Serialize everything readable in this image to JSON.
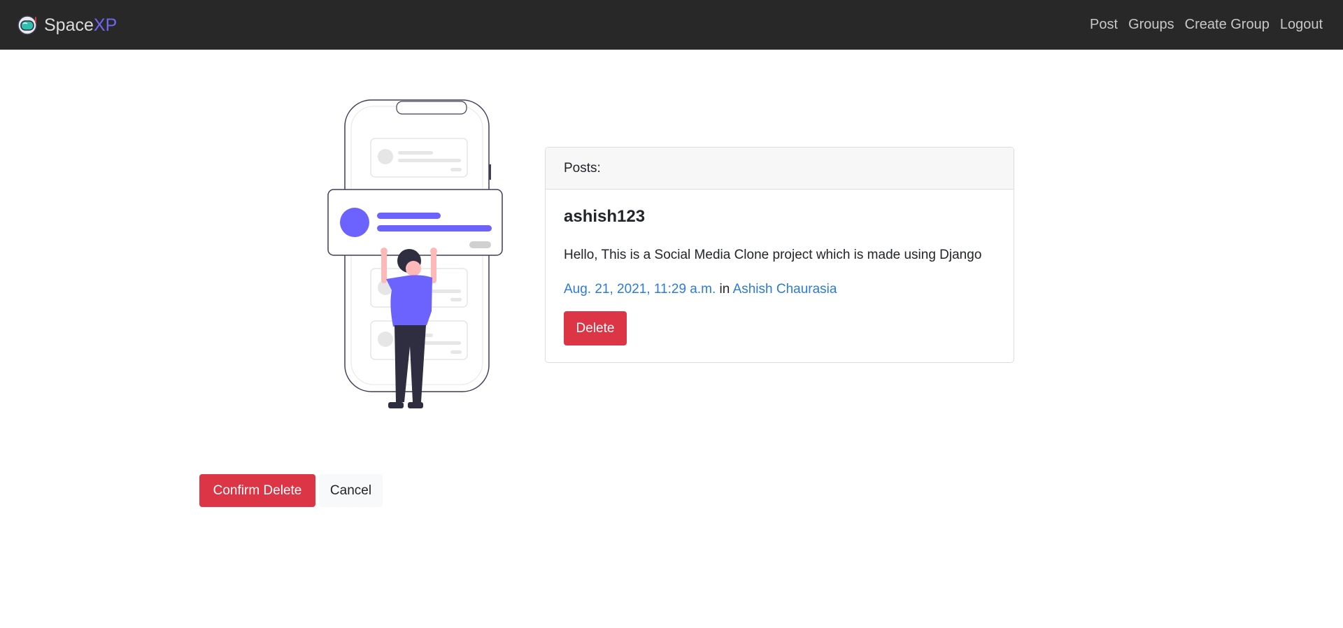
{
  "navbar": {
    "brand": {
      "prefix": "Space",
      "suffix": "XP",
      "icon": "astronaut-helmet-icon"
    },
    "links": [
      {
        "label": "Post"
      },
      {
        "label": "Groups"
      },
      {
        "label": "Create Group"
      },
      {
        "label": "Logout"
      }
    ]
  },
  "illustration": {
    "icon": "person-holding-post-illustration"
  },
  "post_card": {
    "header": "Posts:",
    "author": "ashish123",
    "message": "Hello, This is a Social Media Clone project which is made using Django",
    "timestamp": "Aug. 21, 2021, 11:29 a.m.",
    "in_word": "in",
    "group": "Ashish Chaurasia",
    "delete_label": "Delete"
  },
  "actions": {
    "confirm_label": "Confirm Delete",
    "cancel_label": "Cancel"
  },
  "colors": {
    "navbar_bg": "#282828",
    "brand_accent": "#7067f0",
    "danger": "#dc3545",
    "link": "#2a7ae2",
    "illustration_primary": "#6c63ff"
  }
}
